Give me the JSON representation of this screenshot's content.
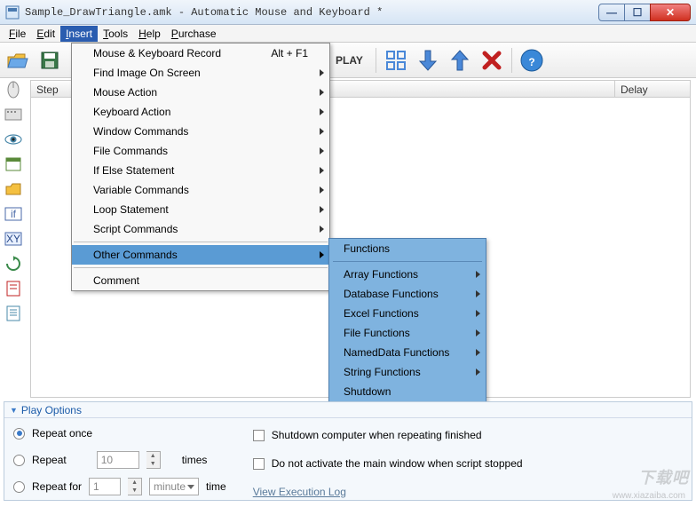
{
  "title": "Sample_DrawTriangle.amk - Automatic Mouse and Keyboard *",
  "menubar": {
    "file": "File",
    "edit": "Edit",
    "insert": "Insert",
    "tools": "Tools",
    "help": "Help",
    "purchase": "Purchase"
  },
  "toolbar": {
    "play": "PLAY"
  },
  "columns": {
    "step": "Step",
    "action": "",
    "delay": "Delay"
  },
  "insert_menu": {
    "mouse_kb_record": "Mouse & Keyboard Record",
    "mouse_kb_record_shortcut": "Alt + F1",
    "find_image": "Find Image On Screen",
    "mouse_action": "Mouse Action",
    "keyboard_action": "Keyboard Action",
    "window_commands": "Window Commands",
    "file_commands": "File Commands",
    "if_else": "If Else Statement",
    "variable_commands": "Variable Commands",
    "loop_statement": "Loop Statement",
    "script_commands": "Script Commands",
    "other_commands": "Other Commands",
    "comment": "Comment"
  },
  "other_submenu": {
    "functions": "Functions",
    "array": "Array Functions",
    "database": "Database Functions",
    "excel": "Excel Functions",
    "file": "File Functions",
    "nameddata": "NamedData Functions",
    "string": "String Functions",
    "shutdown": "Shutdown"
  },
  "play_options": {
    "title": "Play Options",
    "repeat_once": "Repeat once",
    "repeat": "Repeat",
    "repeat_value": "10",
    "times": "times",
    "repeat_for": "Repeat for",
    "repeat_for_value": "1",
    "unit": "minute",
    "time": "time",
    "shutdown": "Shutdown computer when repeating finished",
    "not_activate": "Do not activate the main window when script stopped",
    "view_log": "View Execution Log"
  },
  "watermark": {
    "big": "下载吧",
    "small": "www.xiazaiba.com"
  }
}
